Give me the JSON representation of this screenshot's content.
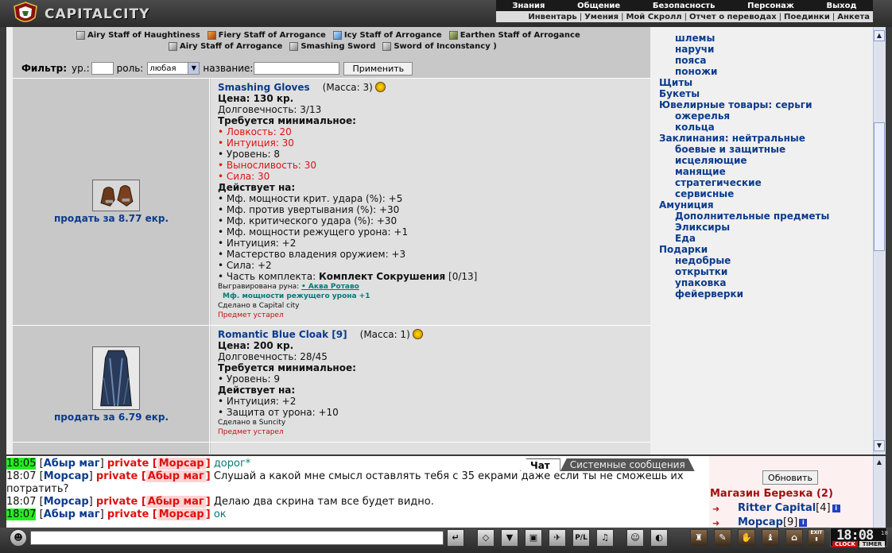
{
  "header": {
    "logo_text": "CAPITALCITY",
    "menu_top": [
      "Знания",
      "Общение",
      "Безопасность",
      "Персонаж",
      "Выход"
    ],
    "menu_bottom": [
      "Инвентарь",
      "Умения",
      "Мой Скролл",
      "Отчет о переводах",
      "Поединки",
      "Анкета"
    ]
  },
  "set_items": {
    "line1": [
      "Airy Staff of Haughtiness",
      "Fiery Staff of Arrogance",
      "Icy Staff of Arrogance",
      "Earthen Staff of Arrogance"
    ],
    "line2": [
      "Airy Staff of Arrogance",
      "Smashing Sword",
      "Sword of Inconstancy )"
    ]
  },
  "filter": {
    "label": "Фильтр:",
    "level_label": "ур.:",
    "role_label": "роль:",
    "role_value": "любая",
    "name_label": "название:",
    "apply_label": "Применить"
  },
  "items": [
    {
      "name": "Smashing Gloves",
      "mass": "(Масса: 3)",
      "price": "Цена: 130 кр.",
      "durability": "Долговечность: 3/13",
      "req_title": "Требуется минимальное:",
      "reqs": [
        {
          "text": "• Ловкость: 20",
          "red": true
        },
        {
          "text": "• Интуиция: 30",
          "red": true
        },
        {
          "text": "• Уровень: 8",
          "red": false
        },
        {
          "text": "• Выносливость: 30",
          "red": true
        },
        {
          "text": "• Сила: 30",
          "red": true
        }
      ],
      "effects_title": "Действует на:",
      "effects": [
        "• Мф. мощности крит. удара (%): +5",
        "• Мф. против увертывания (%): +30",
        "• Мф. критического удара (%): +30",
        "• Мф. мощности режущего урона: +1",
        "• Интуиция: +2",
        "• Мастерство владения оружием: +3",
        "• Сила: +2"
      ],
      "set_prefix": "• Часть комплекта:",
      "set_name": "Комплект Сокрушения",
      "set_count": "[0/13]",
      "rune_prefix": "Выгравирована руна:",
      "rune_name": "• Аква Ротаво",
      "rune_effect": "Мф. мощности режущего урона +1",
      "made_in": "Сделано в Capital city",
      "obsolete": "Предмет устарел",
      "sell_label": "продать за 8.77 екр."
    },
    {
      "name": "Romantic Blue Cloak [9]",
      "mass": "(Масса: 1)",
      "price": "Цена: 200 кр.",
      "durability": "Долговечность: 28/45",
      "req_title": "Требуется минимальное:",
      "reqs": [
        {
          "text": "• Уровень: 9",
          "red": false
        }
      ],
      "effects_title": "Действует на:",
      "effects": [
        "• Интуиция: +2",
        "• Защита от урона: +10"
      ],
      "made_in": "Сделано в Suncity",
      "obsolete": "Предмет устарел",
      "sell_label": "продать за 6.79 екр."
    }
  ],
  "categories": [
    {
      "text": "шлемы",
      "sub": true
    },
    {
      "text": "наручи",
      "sub": true
    },
    {
      "text": "пояса",
      "sub": true
    },
    {
      "text": "поножи",
      "sub": true
    },
    {
      "text": "Щиты",
      "sub": false
    },
    {
      "text": "Букеты",
      "sub": false
    },
    {
      "text": "Ювелирные товары: серьги",
      "sub": false
    },
    {
      "text": "ожерелья",
      "sub": true
    },
    {
      "text": "кольца",
      "sub": true
    },
    {
      "text": "Заклинания: нейтральные",
      "sub": false
    },
    {
      "text": "боевые и защитные",
      "sub": true
    },
    {
      "text": "исцеляющие",
      "sub": true
    },
    {
      "text": "манящие",
      "sub": true
    },
    {
      "text": "стратегические",
      "sub": true
    },
    {
      "text": "сервисные",
      "sub": true
    },
    {
      "text": "Амуниция",
      "sub": false
    },
    {
      "text": "Дополнительные предметы",
      "sub": true
    },
    {
      "text": "Эликсиры",
      "sub": true
    },
    {
      "text": "Еда",
      "sub": true
    },
    {
      "text": "Подарки",
      "sub": false
    },
    {
      "text": "недобрые",
      "sub": true
    },
    {
      "text": "открытки",
      "sub": true
    },
    {
      "text": "упаковка",
      "sub": true
    },
    {
      "text": "фейерверки",
      "sub": true
    }
  ],
  "chat": {
    "tabs": [
      "Чат",
      "Системные сообщения"
    ],
    "messages": [
      {
        "time": "18:05",
        "green": true,
        "from": "Абыр маг",
        "priv": "private [",
        "to": "Морсар",
        "priv_end": "]",
        "text": "дорог*",
        "teal": true
      },
      {
        "time": "18:07",
        "green": false,
        "from": "Морсар",
        "priv": "private [",
        "to": "Абыр маг",
        "priv_end": "]",
        "text": "Слушай а какой мне смысл оставлять тебя с 35 екрами даже если ты не сможешь их",
        "teal": false
      },
      {
        "cont": "потратить?"
      },
      {
        "time": "18:07",
        "green": false,
        "from": "Морсар",
        "priv": "private [",
        "to": "Абыр маг",
        "priv_end": "]",
        "text": "Делаю два скрина там все будет видно.",
        "teal": false
      },
      {
        "time": "18:07",
        "green": true,
        "from": "Абыр маг",
        "priv": "private [",
        "to": "Морсар",
        "priv_end": "]",
        "text": "ок",
        "teal": true
      }
    ]
  },
  "online": {
    "refresh_label": "Обновить",
    "shop": "Магазин Березка (2)",
    "users": [
      {
        "name": "Ritter Capital",
        "level": "[4]"
      },
      {
        "name": "Морсар",
        "level": "[9]"
      }
    ]
  },
  "clock": {
    "time": "18:08",
    "seconds": "18",
    "clock_label": "CLOCK",
    "timer_label": "TIMER"
  },
  "toolbar": {
    "pl_label": "P/L",
    "exit_label": "EXIT"
  }
}
